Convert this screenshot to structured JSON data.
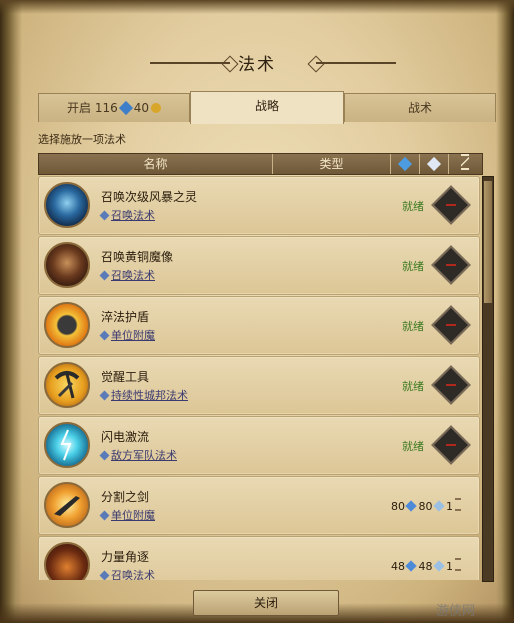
{
  "window": {
    "title": "法术"
  },
  "tabs": [
    {
      "label": "开启",
      "value": "116",
      "extra": "40"
    },
    {
      "label": "战略"
    },
    {
      "label": "战术"
    }
  ],
  "subtitle": "选择施放一项法术",
  "table": {
    "headers": {
      "name": "名称",
      "type": "类型"
    },
    "rows": [
      {
        "name": "召唤次级风暴之灵",
        "type": "召唤法术",
        "status": "就绪",
        "icon": "storm-spirit-icon"
      },
      {
        "name": "召唤黄铜魔像",
        "type": "召唤法术",
        "status": "就绪",
        "icon": "brass-golem-icon"
      },
      {
        "name": "淬法护盾",
        "type": "单位附魔",
        "status": "就绪",
        "icon": "spell-shield-icon"
      },
      {
        "name": "觉醒工具",
        "type": "持续性城邦法术",
        "status": "就绪",
        "icon": "pickaxe-hammer-icon"
      },
      {
        "name": "闪电激流",
        "type": "敌方军队法术",
        "status": "就绪",
        "icon": "lightning-icon"
      },
      {
        "name": "分割之剑",
        "type": "单位附魔",
        "cost1": "80",
        "cost2": "80",
        "duration": "1",
        "icon": "sword-icon"
      },
      {
        "name": "力量角逐",
        "type": "召唤法术",
        "cost1": "48",
        "cost2": "48",
        "duration": "1",
        "icon": "strength-icon"
      }
    ]
  },
  "footer": {
    "close_label": "关闭"
  },
  "watermark": "游侠网",
  "colors": {
    "ready": "#3d7a20",
    "mana": "#4d8ad8",
    "parchment": "#e2cda0"
  }
}
